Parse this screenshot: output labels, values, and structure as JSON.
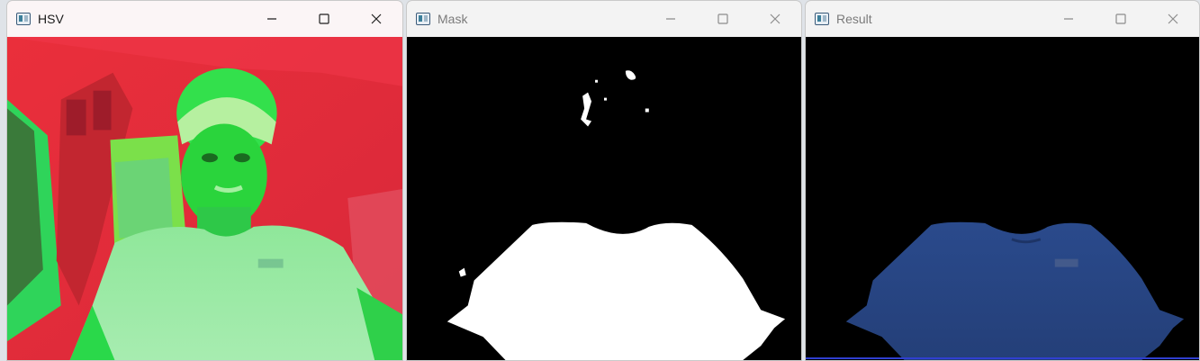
{
  "windows": [
    {
      "title": "HSV",
      "state": "active",
      "view": "hsv",
      "buttons": {
        "minimize": "minimize-icon",
        "maximize": "maximize-icon",
        "close": "close-icon"
      }
    },
    {
      "title": "Mask",
      "state": "inactive",
      "view": "mask",
      "buttons": {
        "minimize": "minimize-icon",
        "maximize": "maximize-icon",
        "close": "close-icon"
      }
    },
    {
      "title": "Result",
      "state": "inactive",
      "view": "result",
      "buttons": {
        "minimize": "minimize-icon",
        "maximize": "maximize-icon",
        "close": "close-icon"
      }
    }
  ],
  "colors": {
    "hsv_background": "#e8313c",
    "hsv_subject": "#3cf062",
    "mask_foreground": "#ffffff",
    "mask_background": "#000000",
    "result_shirt": "#2a4c8f"
  }
}
